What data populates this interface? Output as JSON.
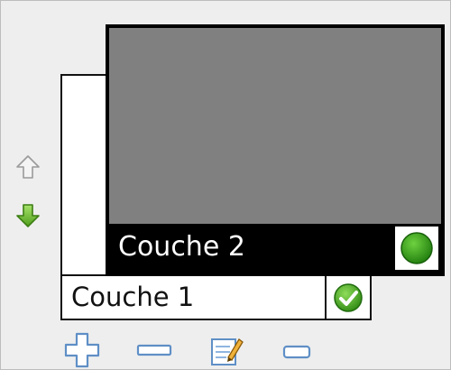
{
  "layers": [
    {
      "name": "Couche 2",
      "selected": true,
      "visibility_icon": "green-dot-icon"
    },
    {
      "name": "Couche 1",
      "selected": false,
      "visibility_icon": "green-check-icon"
    }
  ],
  "controls": {
    "move_up_icon": "arrow-up-icon",
    "move_down_icon": "arrow-down-icon",
    "toolbar": [
      "plus-icon",
      "minus-icon",
      "edit-icon",
      "collapse-icon"
    ]
  },
  "colors": {
    "selected_fill": "#808080",
    "selected_footer": "#000000",
    "accent_green": "#4aa31f",
    "icon_blue": "#7aa7d8"
  }
}
